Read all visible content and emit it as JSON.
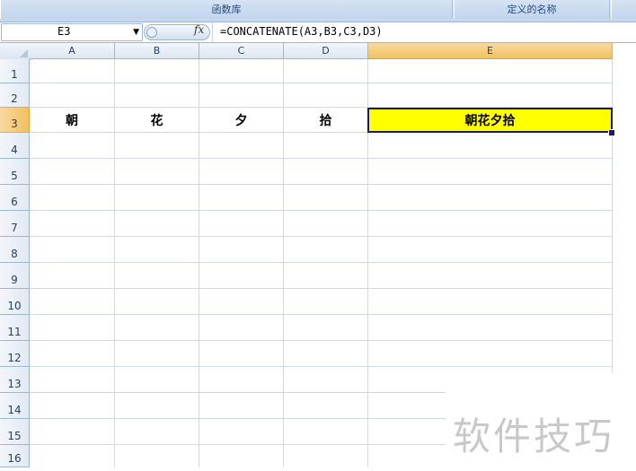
{
  "ribbon": {
    "groups": [
      "函数库",
      "定义的名称"
    ]
  },
  "formula_bar": {
    "name_box": "E3",
    "fx_label": "fx",
    "formula": "=CONCATENATE(A3,B3,C3,D3)"
  },
  "columns": [
    "A",
    "B",
    "C",
    "D",
    "E"
  ],
  "rows": [
    "1",
    "2",
    "3",
    "4",
    "5",
    "6",
    "7",
    "8",
    "9",
    "10",
    "11",
    "12",
    "13",
    "14",
    "15",
    "16"
  ],
  "cells": {
    "A3": "朝",
    "B3": "花",
    "C3": "夕",
    "D3": "拾",
    "E3": "朝花夕拾"
  },
  "active_cell": "E3",
  "watermark": "软件技巧",
  "colors": {
    "selection_fill": "#ffff00",
    "selection_border": "#1c1c5c",
    "header_selected": "#f1c15f"
  }
}
